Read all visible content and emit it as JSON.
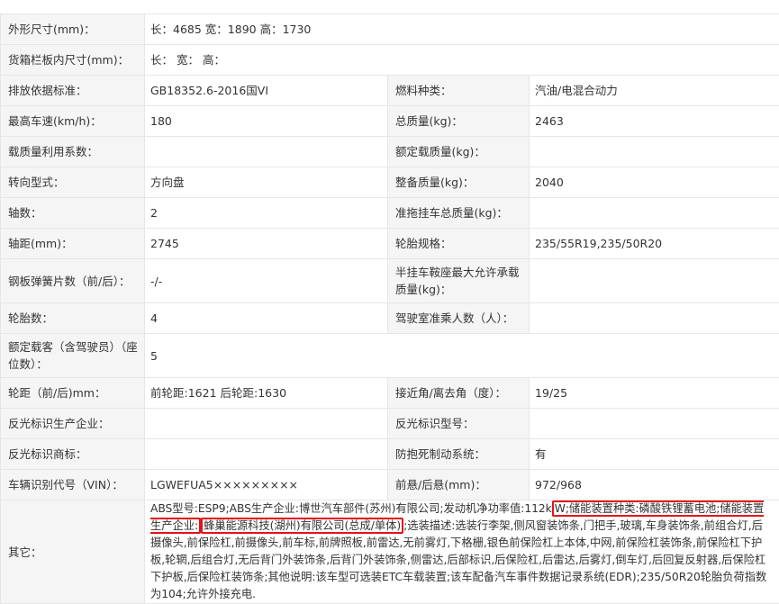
{
  "specs": {
    "dimensions": {
      "label": "外形尺寸(mm)：",
      "value": "长：4685 宽：1890 高：1730"
    },
    "cargo": {
      "label": "货箱栏板内尺寸(mm)：",
      "value": "长： 宽： 高："
    },
    "emission": {
      "label": "排放依据标准：",
      "value": "GB18352.6-2016国VI"
    },
    "fuel": {
      "label": "燃料种类：",
      "value": "汽油/电混合动力"
    },
    "max_speed": {
      "label": "最高车速(km/h)：",
      "value": "180"
    },
    "total_mass": {
      "label": "总质量(kg)：",
      "value": "2463"
    },
    "load_util": {
      "label": "载质量利用系数：",
      "value": ""
    },
    "rated_load": {
      "label": "额定载质量(kg)：",
      "value": ""
    },
    "steering": {
      "label": "转向型式：",
      "value": "方向盘"
    },
    "curb_mass": {
      "label": "整备质量(kg)：",
      "value": "2040"
    },
    "axles": {
      "label": "轴数：",
      "value": "2"
    },
    "trailer_mass": {
      "label": "准拖挂车总质量(kg)：",
      "value": ""
    },
    "wheelbase": {
      "label": "轴距(mm)：",
      "value": "2745"
    },
    "tires": {
      "label": "轮胎规格：",
      "value": "235/55R19,235/50R20"
    },
    "springs": {
      "label": "钢板弹簧片数（前/后）：",
      "value": "-/-"
    },
    "saddle": {
      "label": "半挂车鞍座最大允许承载质量(kg)：",
      "value": ""
    },
    "tire_count": {
      "label": "轮胎数：",
      "value": "4"
    },
    "cab_seats": {
      "label": "驾驶室准乘人数（人）：",
      "value": ""
    },
    "passengers": {
      "label": "额定载客（含驾驶员）（座位数）：",
      "value": "5"
    },
    "track": {
      "label": "轮距（前/后)mm：",
      "value": "前轮距:1621 后轮距:1630"
    },
    "angles": {
      "label": "接近角/离去角（度）：",
      "value": "19/25"
    },
    "reflector_maker": {
      "label": "反光标识生产企业：",
      "value": ""
    },
    "reflector_model": {
      "label": "反光标识型号：",
      "value": ""
    },
    "reflector_brand": {
      "label": "反光标识商标：",
      "value": ""
    },
    "abs": {
      "label": "防抱死制动系统：",
      "value": "有"
    },
    "vin": {
      "label": "车辆识别代号（VIN）：",
      "value": "LGWEFUA5×××××××××"
    },
    "overhang": {
      "label": "前悬/后悬(mm)：",
      "value": "972/968"
    }
  },
  "other": {
    "label": "其它：",
    "text_a": "ABS型号:ESP9;ABS生产企业:博世汽车部件(苏州)有限公司;发动机净功率值:112k",
    "highlight_1": "W;储能装置种类:磷酸铁锂蓄电池;储能装置生产企业:",
    "highlight_2": "蜂巢能源科技(湖州)有限公司(总成/单体)",
    "text_b": ";选装描述:选装行李架,侧风窗装饰条,门把手,玻璃,车身装饰条,前组合灯,后摄像头,前保险杠,前摄像头,前车标,前牌照板,前雷达,无前雾灯,下格栅,银色前保险杠上本体,中网,前保险杠装饰条,前保险杠下护板,轮辋,后组合灯,无后背门外装饰条,后背门外装饰条,侧雷达,后部标识,后保险杠,后雷达,后雾灯,倒车灯,后回复反射器,后保险杠下护板,后保险杠装饰条;其他说明:该车型可选装ETC车载装置;该车配备汽车事件数据记录系统(EDR);235/50R20轮胎负荷指数为104;允许外接充电."
  },
  "colors": {
    "label_bg": "#f5f5f5",
    "border": "#e6e6e6",
    "highlight": "#e3111b"
  }
}
